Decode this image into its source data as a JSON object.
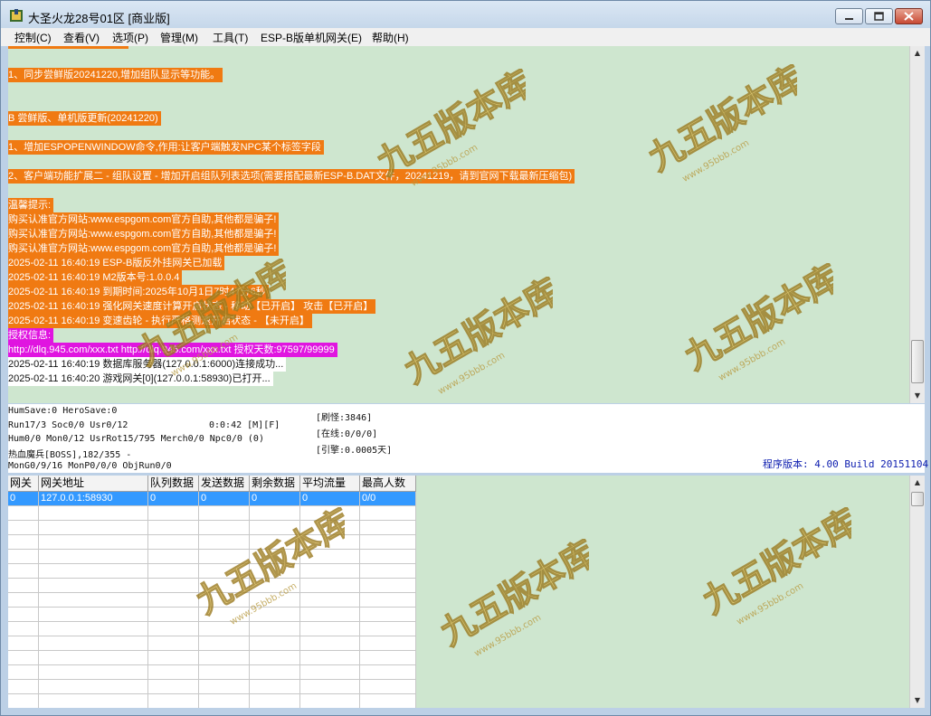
{
  "window": {
    "title": "大圣火龙28号01区 [商业版]"
  },
  "menu": [
    {
      "label": "控制(C)"
    },
    {
      "label": "查看(V)"
    },
    {
      "label": "选项(P)"
    },
    {
      "label": "管理(M)"
    },
    {
      "label": "工具(T)"
    },
    {
      "label": "ESP-B版单机网关(E)"
    },
    {
      "label": "帮助(H)"
    }
  ],
  "log": [
    {
      "text": "1、同步尝鲜版20241220,增加组队显示等功能。",
      "style": "orange"
    },
    {
      "text": "B 尝鲜版、单机版更新(20241220)",
      "style": "orange"
    },
    {
      "text": "1、增加ESPOPENWINDOW命令,作用:让客户端触发NPC某个标签字段",
      "style": "orange"
    },
    {
      "text": "2、客户端功能扩展二 - 组队设置 - 增加开启组队列表选项(需要搭配最新ESP-B.DAT文件，20241219，请到官网下载最新压缩包)",
      "style": "orange"
    },
    {
      "text": "温馨提示:",
      "style": "orange"
    },
    {
      "text": "购买认准官方网站:www.espgom.com官方自助,其他都是骗子!",
      "style": "orange"
    },
    {
      "text": "购买认准官方网站:www.espgom.com官方自助,其他都是骗子!",
      "style": "orange"
    },
    {
      "text": "购买认准官方网站:www.espgom.com官方自助,其他都是骗子!",
      "style": "orange"
    },
    {
      "text": "2025-02-11 16:40:19 ESP-B版反外挂网关已加载",
      "style": "orange"
    },
    {
      "text": "2025-02-11 16:40:19 M2版本号:1.0.0.4",
      "style": "orange"
    },
    {
      "text": "2025-02-11 16:40:19 到期时间:2025年10月1日7时47分6秒",
      "style": "orange"
    },
    {
      "text": "2025-02-11 16:40:19 强化网关速度计算开启状态 - 移动【已开启】 攻击【已开启】",
      "style": "orange"
    },
    {
      "text": "2025-02-11 16:40:19 变速齿轮 - 执行严格测速开启状态 - 【未开启】",
      "style": "orange"
    },
    {
      "text": "授权信息:",
      "style": "magenta"
    },
    {
      "text": "http://dlq.945.com/xxx.txt http://dlq.945.com/xxx.txt 授权天数:97597/99999",
      "style": "magenta"
    },
    {
      "text": "2025-02-11 16:40:19 数据库服务器(127.0.0.1:6000)连接成功...",
      "style": "plain"
    },
    {
      "text": "2025-02-11 16:40:20 游戏网关[0](127.0.0.1:58930)已打开...",
      "style": "plain"
    }
  ],
  "status": {
    "line1": "HumSave:0 HeroSave:0",
    "line2": "Run17/3 Soc0/0 Usr0/12",
    "time": "0:0:42 [M][F]",
    "line3": "Hum0/0 Mon0/12 UsrRot15/795 Merch0/0 Npc0/0 (0)",
    "line4": "热血魔兵[BOSS],182/355 -",
    "line5": "MonG0/9/16 MonP0/0/0 ObjRun0/0",
    "refresh": "[刷怪:3846]",
    "online": "[在线:0/0/0]",
    "engine": "[引擎:0.0005天]",
    "version": "程序版本: 4.00 Build 20151104"
  },
  "grid": {
    "headers": [
      "网关",
      "网关地址",
      "队列数据",
      "发送数据",
      "剩余数据",
      "平均流量",
      "最高人数"
    ],
    "rows": [
      [
        "0",
        "127.0.0.1:58930",
        "0",
        "0",
        "0",
        "0",
        "0/0"
      ]
    ]
  },
  "watermark": {
    "text": "九五版本库",
    "subtext": "www.95bbb.com"
  },
  "colors": {
    "log_bg": "#cee6cf",
    "orange": "#f07a12",
    "magenta": "#e015e0",
    "selected": "#3399ff",
    "version": "#1020b0"
  }
}
